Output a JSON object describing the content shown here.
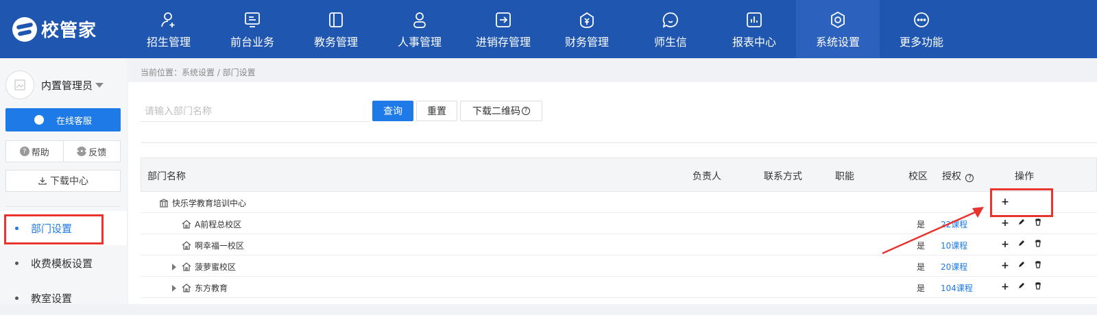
{
  "app": {
    "logo_text": "校管家"
  },
  "nav": [
    {
      "label": "招生管理",
      "icon": "user-plus-icon"
    },
    {
      "label": "前台业务",
      "icon": "monitor-icon"
    },
    {
      "label": "教务管理",
      "icon": "book-icon"
    },
    {
      "label": "人事管理",
      "icon": "person-icon"
    },
    {
      "label": "进销存管理",
      "icon": "arrow-box-icon"
    },
    {
      "label": "财务管理",
      "icon": "money-bag-icon"
    },
    {
      "label": "师生信",
      "icon": "chat-bubble-icon"
    },
    {
      "label": "报表中心",
      "icon": "bar-report-icon"
    },
    {
      "label": "系统设置",
      "icon": "settings-hexagon-icon"
    },
    {
      "label": "更多功能",
      "icon": "more-dots-icon"
    }
  ],
  "sidebar": {
    "user_name": "内置管理员",
    "online_service": "在线客服",
    "help": "帮助",
    "feedback": "反馈",
    "download_center": "下载中心",
    "menu": [
      {
        "label": "部门设置"
      },
      {
        "label": "收费模板设置"
      },
      {
        "label": "教室设置"
      }
    ]
  },
  "breadcrumb": "当前位置：系统设置 / 部门设置",
  "search": {
    "placeholder": "请输入部门名称",
    "query_label": "查询",
    "reset_label": "重置",
    "qrcode_label": "下载二维码"
  },
  "table": {
    "headers": {
      "name": "部门名称",
      "manager": "负责人",
      "contact": "联系方式",
      "function": "职能",
      "campus": "校区",
      "auth": "授权",
      "ops": "操作"
    },
    "rows": [
      {
        "name": "快乐学教育培训中心",
        "campus": "",
        "auth": ""
      },
      {
        "name": "A前程总校区",
        "campus": "是",
        "auth": "22课程"
      },
      {
        "name": "啊幸福一校区",
        "campus": "是",
        "auth": "10课程"
      },
      {
        "name": "菠萝蜜校区",
        "campus": "是",
        "auth": "20课程"
      },
      {
        "name": "东方教育",
        "campus": "是",
        "auth": "104课程"
      }
    ]
  },
  "colors": {
    "brand": "#1e56b0",
    "accent": "#1e7ae6",
    "highlight": "#e8332f"
  }
}
